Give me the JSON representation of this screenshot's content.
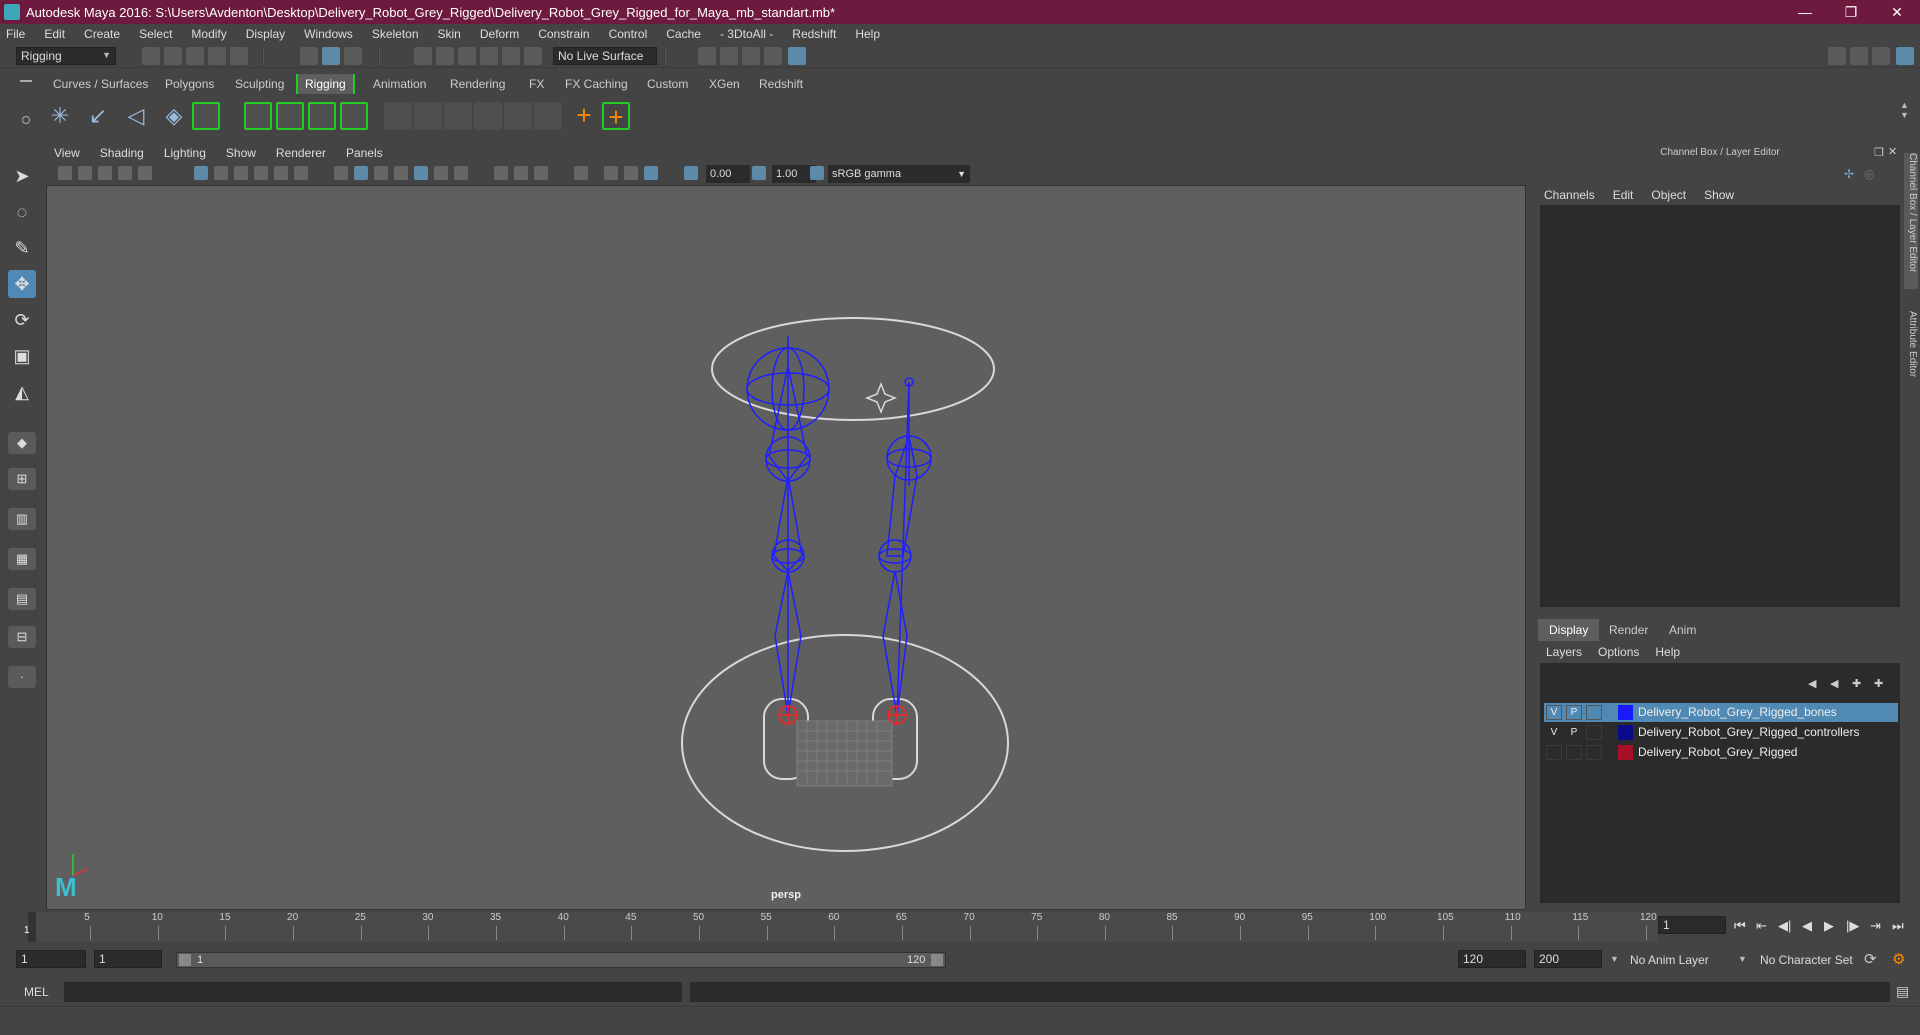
{
  "window": {
    "title": "Autodesk Maya 2016: S:\\Users\\Avdenton\\Desktop\\Delivery_Robot_Grey_Rigged\\Delivery_Robot_Grey_Rigged_for_Maya_mb_standart.mb*",
    "minimize": "—",
    "maximize": "❐",
    "close": "✕"
  },
  "menus": [
    "File",
    "Edit",
    "Create",
    "Select",
    "Modify",
    "Display",
    "Windows",
    "Skeleton",
    "Skin",
    "Deform",
    "Constrain",
    "Control",
    "Cache",
    "- 3DtoAll -",
    "Redshift",
    "Help"
  ],
  "status_line": {
    "menu_set": "Rigging",
    "live_surface": "No Live Surface"
  },
  "shelf_tabs": [
    "Curves / Surfaces",
    "Polygons",
    "Sculpting",
    "Rigging",
    "Animation",
    "Rendering",
    "FX",
    "FX Caching",
    "Custom",
    "XGen",
    "Redshift"
  ],
  "active_shelf": "Rigging",
  "viewport_menu": [
    "View",
    "Shading",
    "Lighting",
    "Show",
    "Renderer",
    "Panels"
  ],
  "viewport_toolbar": {
    "exposure": "0.00",
    "gamma": "1.00",
    "colorspace": "sRGB gamma"
  },
  "viewport": {
    "camera": "persp"
  },
  "channel_box": {
    "title": "Channel Box / Layer Editor",
    "menu": [
      "Channels",
      "Edit",
      "Object",
      "Show"
    ]
  },
  "layer_editor": {
    "tabs": [
      "Display",
      "Render",
      "Anim"
    ],
    "active_tab": "Display",
    "menu": [
      "Layers",
      "Options",
      "Help"
    ],
    "layers": [
      {
        "v": "V",
        "p": "P",
        "color": "#1a1aff",
        "name": "Delivery_Robot_Grey_Rigged_bones",
        "selected": true
      },
      {
        "v": "V",
        "p": "P",
        "color": "#0a0a8a",
        "name": "Delivery_Robot_Grey_Rigged_controllers",
        "selected": false
      },
      {
        "v": "",
        "p": "",
        "color": "#a8102a",
        "name": "Delivery_Robot_Grey_Rigged",
        "selected": false
      }
    ]
  },
  "side_tabs": [
    "Channel Box / Layer Editor",
    "Attribute Editor"
  ],
  "time_slider": {
    "ticks": [
      "1",
      "5",
      "10",
      "15",
      "20",
      "25",
      "30",
      "35",
      "40",
      "45",
      "50",
      "55",
      "60",
      "65",
      "70",
      "75",
      "80",
      "85",
      "90",
      "95",
      "100",
      "105",
      "110",
      "115",
      "120"
    ],
    "current_frame": "1"
  },
  "transport": [
    "⏮",
    "⇤",
    "◀|",
    "◀",
    "▶",
    "|▶",
    "⇥",
    "⏭"
  ],
  "range": {
    "start": "1",
    "playback_start": "1",
    "range_start_label": "1",
    "range_end_label": "120",
    "playback_end": "120",
    "end": "200",
    "anim_layer": "No Anim Layer",
    "char_set": "No Character Set"
  },
  "command_line": {
    "lang": "MEL"
  }
}
